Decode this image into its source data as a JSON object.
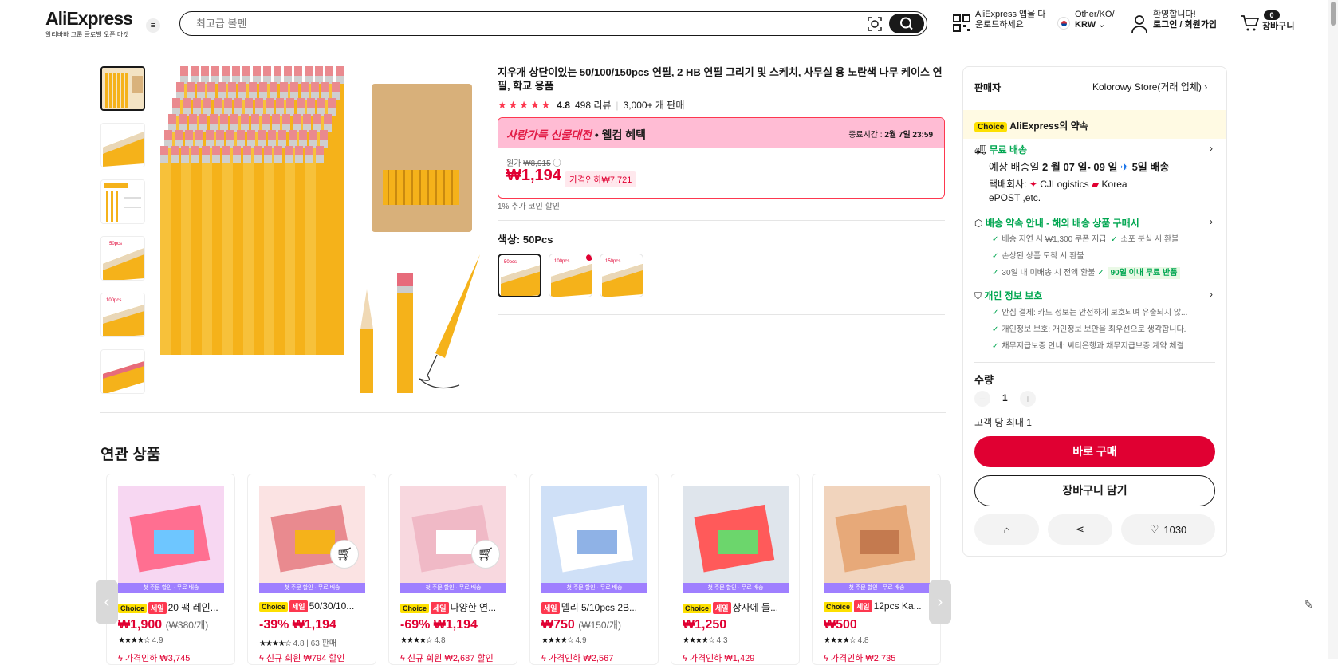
{
  "header": {
    "logo": "AliExpress",
    "logo_sub": "알리바바 그룹 글로벌 오픈 마켓",
    "search_placeholder": "최고급 볼펜",
    "app_download": [
      "AliExpress 앱을 다",
      "운로드하세요"
    ],
    "region_top": "Other/KO/",
    "region_currency": "KRW",
    "account_top": "환영합니다!",
    "account_bottom": "로그인 / 회원가입",
    "cart_count": "0",
    "cart_label": "장바구니"
  },
  "product": {
    "title": "지우개 상단이있는 50/100/150pcs 연필, 2 HB 연필 그리기 및 스케치, 사무실 용 노란색 나무 케이스 연필, 학교 용품",
    "rating": "4.8",
    "reviews": "498 리뷰",
    "sold": "3,000+ 개 판매",
    "promo_name_1": "사랑가득 신물대전",
    "promo_name_2": " • 웰컴 혜택",
    "promo_end_label": "종료시간 : ",
    "promo_end": "2월 7일 23:59",
    "orig_label": "원가",
    "orig_price": "₩8,915",
    "price": "₩1,194",
    "discount": "가격인하₩7,721",
    "coin": "1% 추가 코인 할인",
    "color_label": "색상: 50Pcs",
    "sku_tags": [
      "50pcs",
      "100pcs",
      "150pcs"
    ]
  },
  "seller": {
    "label": "판매자",
    "store": "Kolorowy Store(거래 업체)",
    "promise": "AliExpress의 약속",
    "choice": "Choice",
    "free_ship": "무료 배송",
    "delivery_prefix": "예상 배송일 ",
    "delivery_dates": "2 월 07 일- 09 일",
    "delivery_days": "5일 배송",
    "carrier_label": "택배회사: ",
    "carrier_1": "CJLogistics",
    "carrier_2": "Korea",
    "carrier_3": "ePOST ,etc.",
    "guarantee_title": "배송 약속 안내 - 해외 배송 상품 구매시",
    "g1": "배송 지연 시 ₩1,300 쿠폰 지급",
    "g2": "소포 분실 시 환불",
    "g3": "손상된 상품 도착 시 환불",
    "g4": "30일 내 미배송 시 전액 환불",
    "g5": "90일 이내 무료 반품",
    "privacy_title": "개인 정보 보호",
    "p1": "안심 결제: 카드 정보는 안전하게 보호되며 유출되지 않...",
    "p2": "개인정보 보호: 개인정보 보안을 최우선으로 생각합니다.",
    "p3": "채무지급보증 안내: 씨티은행과 채무지급보증 계약 체결",
    "qty_label": "수량",
    "qty": "1",
    "qty_limit": "고객 당 최대 1",
    "buy": "바로 구매",
    "add_cart": "장바구니 담기",
    "wish_count": "1030"
  },
  "related": {
    "title": "연관 상품",
    "bar_text": "첫 주문 할인 · 무료 배송",
    "items": [
      {
        "tags": [
          "Choice",
          "세일"
        ],
        "title": "20 팩 레인...",
        "price": "₩1,900",
        "unit": "(₩380/개)",
        "rating": "4.9",
        "sold": "",
        "promo": "가격인하 ₩3,745"
      },
      {
        "tags": [
          "Choice",
          "세일"
        ],
        "title": "50/30/10...",
        "price": "-39% ₩1,194",
        "unit": "",
        "rating": "4.8",
        "sold": "63 판매",
        "promo": "신규 회원 ₩794 할인"
      },
      {
        "tags": [
          "Choice",
          "세일"
        ],
        "title": "다양한 연...",
        "price": "-69% ₩1,194",
        "unit": "",
        "rating": "4.8",
        "sold": "",
        "promo": "신규 회원 ₩2,687 할인"
      },
      {
        "tags": [
          "세일"
        ],
        "title": "델리 5/10pcs 2B...",
        "price": "₩750",
        "unit": "(₩150/개)",
        "rating": "4.9",
        "sold": "",
        "promo": "가격인하 ₩2,567"
      },
      {
        "tags": [
          "Choice",
          "세일"
        ],
        "title": "상자에 들...",
        "price": "₩1,250",
        "unit": "",
        "rating": "4.3",
        "sold": "",
        "promo": "가격인하 ₩1,429"
      },
      {
        "tags": [
          "Choice",
          "세일"
        ],
        "title": "12pcs Ka...",
        "price": "₩500",
        "unit": "",
        "rating": "4.8",
        "sold": "",
        "promo": "가격인하 ₩2,735"
      }
    ]
  },
  "colors": {
    "accent": "#e00032",
    "choice": "#fde000",
    "green": "#00a650",
    "promo_bg": "#ffbcd4"
  }
}
